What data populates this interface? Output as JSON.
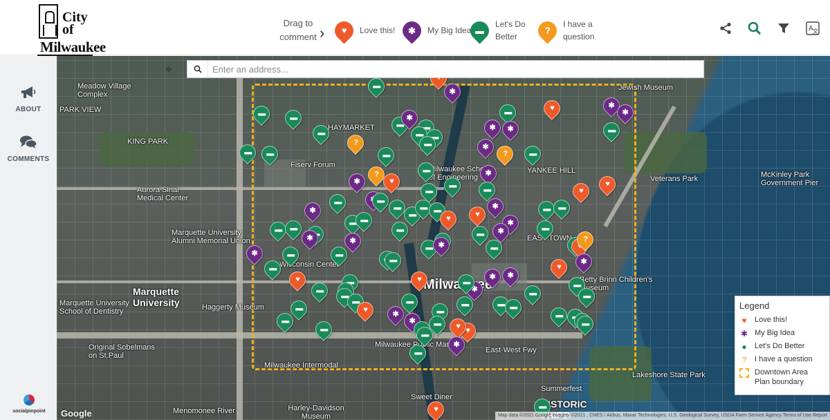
{
  "header": {
    "logo": {
      "line1": "City",
      "line2": "of",
      "line3": "Milwaukee"
    },
    "drag_hint": "Drag to comment",
    "categories": [
      {
        "label": "Love this!",
        "icon": "heart-icon",
        "color": "#ef5a2a"
      },
      {
        "label": "My Big Idea",
        "icon": "lightbulb-icon",
        "color": "#6b2a85"
      },
      {
        "label": "Let's Do Better",
        "icon": "speech-bubble-icon",
        "color": "#1a8a5a"
      },
      {
        "label": "I have a question",
        "icon": "question-icon",
        "color": "#f39a1e"
      }
    ],
    "actions": [
      {
        "name": "share-icon",
        "glyph": "⋖"
      },
      {
        "name": "search-icon",
        "glyph": "⌕"
      },
      {
        "name": "filter-icon",
        "glyph": "▼"
      },
      {
        "name": "translate-icon",
        "glyph": "文"
      }
    ]
  },
  "sidebar": {
    "items": [
      {
        "label": "ABOUT",
        "icon": "megaphone-icon"
      },
      {
        "label": "COMMENTS",
        "icon": "comments-icon"
      }
    ],
    "brand": "socialpinpoint"
  },
  "map": {
    "search": {
      "placeholder": "Enter an address..."
    },
    "labels": [
      {
        "text": "Milwaukee"
      },
      {
        "text": "KING PARK"
      },
      {
        "text": "HAYMARKET"
      },
      {
        "text": "EAST TOWN"
      },
      {
        "text": "YANKEE HILL"
      },
      {
        "text": "Marquette University"
      },
      {
        "text": "PARK VIEW"
      },
      {
        "text": "Veterans Park"
      },
      {
        "text": "Lakeshore State Park"
      },
      {
        "text": "Fiserv Forum"
      },
      {
        "text": "Wisconsin Center"
      },
      {
        "text": "Summerfest"
      },
      {
        "text": "Harley-Davidson Museum"
      },
      {
        "text": "McKinley Park Government Pier"
      },
      {
        "text": "Aurora Sinai Medical Center"
      },
      {
        "text": "Milwaukee Intermodal"
      },
      {
        "text": "Original Sobelmans on St.Paul"
      },
      {
        "text": "Sweet Diner"
      },
      {
        "text": "Marquette University Alumni Memorial Union"
      },
      {
        "text": "Haggerty Museum"
      },
      {
        "text": "Milwaukee School of Engineering"
      },
      {
        "text": "Jewish Museum"
      },
      {
        "text": "Betty Brinn Children's Museum"
      },
      {
        "text": "Milwaukee Public Market"
      },
      {
        "text": "HISTORIC THIRD WARD"
      },
      {
        "text": "Menomonee River"
      },
      {
        "text": "East-West Fwy"
      },
      {
        "text": "Meadow Village Complex"
      },
      {
        "text": "Marquette University School of Dentistry"
      }
    ],
    "google": "Google",
    "attribution": "Map data ©2021 Google Imagery ©2021 , CNES / Airbus, Maxar Technologies, U.S. Geological Survey, USDA Farm Service Agency  Terms of Use  Report"
  },
  "legend": {
    "title": "Legend",
    "items": [
      {
        "label": "Love this!",
        "icon": "heart-icon",
        "color": "#ef5a2a"
      },
      {
        "label": "My Big Idea",
        "icon": "lightbulb-icon",
        "color": "#6b2a85"
      },
      {
        "label": "Let's Do Better",
        "icon": "speech-bubble-icon",
        "color": "#1a8a5a"
      },
      {
        "label": "I have a question",
        "icon": "question-icon",
        "color": "#f39a1e"
      },
      {
        "label": "Downtown Area Plan boundary",
        "icon": "dashed-boundary-icon",
        "color": "#f0b21e"
      }
    ]
  }
}
